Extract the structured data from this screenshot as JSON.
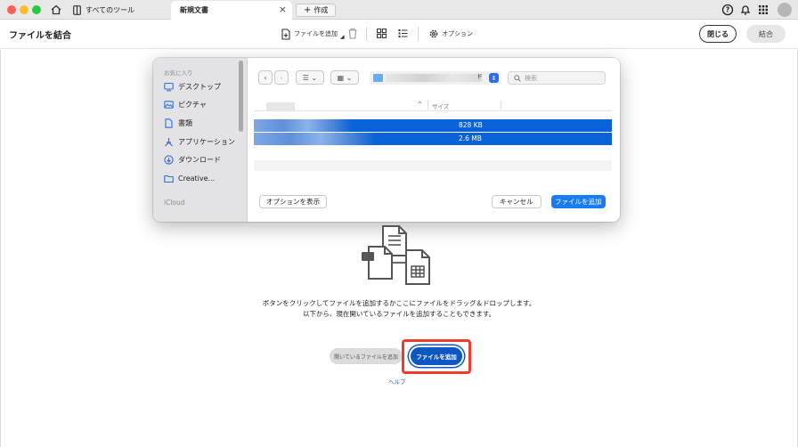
{
  "titlebar": {
    "tools_tab_label": "すべてのツール",
    "active_tab_label": "新規文書",
    "new_tab_label": "作成"
  },
  "toolbar": {
    "title": "ファイルを結合",
    "add_files_label": "ファイルを追加",
    "options_label": "オプション",
    "close_label": "閉じる",
    "combine_label": "結合"
  },
  "dialog": {
    "sidebar": {
      "favorites_heading": "お気に入り",
      "items": [
        {
          "label": "デスクトップ",
          "icon": "desktop-icon"
        },
        {
          "label": "ピクチャ",
          "icon": "picture-icon"
        },
        {
          "label": "書類",
          "icon": "document-icon"
        },
        {
          "label": "アプリケーション",
          "icon": "applications-icon"
        },
        {
          "label": "ダウンロード",
          "icon": "download-icon"
        },
        {
          "label": "Creative...",
          "icon": "folder-icon"
        }
      ],
      "icloud_heading": "iCloud"
    },
    "location_suffix": "ド",
    "search_placeholder": "検索",
    "columns": {
      "size": "サイズ"
    },
    "files": [
      {
        "size": "828 KB"
      },
      {
        "size": "2.6 MB"
      }
    ],
    "show_options_label": "オプションを表示",
    "cancel_label": "キャンセル",
    "add_file_label": "ファイルを追加"
  },
  "main": {
    "instruction_line1": "ボタンをクリックしてファイルを追加するかここにファイルをドラッグ＆ドロップします。",
    "instruction_line2": "以下から、現在開いているファイルを追加することもできます。",
    "add_open_files_label": "開いているファイルを追加",
    "add_file_label": "ファイルを追加",
    "help_label": "ヘルプ"
  },
  "colors": {
    "accent": "#0d57c4",
    "highlight": "#ef3c2d",
    "selection": "#0a62d8"
  }
}
